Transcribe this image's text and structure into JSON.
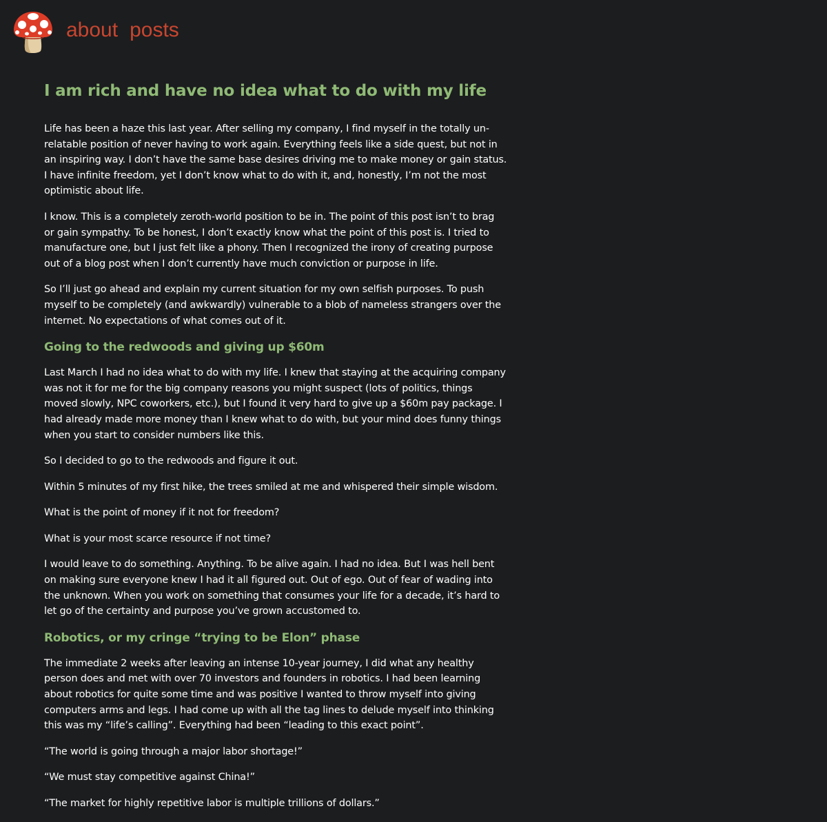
{
  "nav": {
    "logo_icon": "mushroom-icon",
    "links": [
      {
        "label": "about"
      },
      {
        "label": "posts"
      }
    ],
    "link_color": "#c8462f"
  },
  "article": {
    "title": "I am rich and have no idea what to do with my life",
    "accent_color": "#8fba75",
    "intro_paragraphs": [
      "Life has been a haze this last year. After selling my company, I find myself in the totally un-relatable position of never having to work again. Everything feels like a side quest, but not in an inspiring way. I don’t have the same base desires driving me to make money or gain status. I have infinite freedom, yet I don’t know what to do with it, and, honestly, I’m not the most optimistic about life.",
      "I know. This is a completely zeroth-world position to be in. The point of this post isn’t to brag or gain sympathy. To be honest, I don’t exactly know what the point of this post is. I tried to manufacture one, but I just felt like a phony. Then I recognized the irony of creating purpose out of a blog post when I don’t currently have much conviction or purpose in life.",
      "So I’ll just go ahead and explain my current situation for my own selfish purposes. To push myself to be completely (and awkwardly) vulnerable to a blob of nameless strangers over the internet. No expectations of what comes out of it."
    ],
    "sections": [
      {
        "heading": "Going to the redwoods and giving up $60m",
        "paragraphs": [
          "Last March I had no idea what to do with my life. I knew that staying at the acquiring company was not it for me for the big company reasons you might suspect (lots of politics, things moved slowly, NPC coworkers, etc.), but I found it very hard to give up a $60m pay package. I had already made more money than I knew what to do with, but your mind does funny things when you start to consider numbers like this.",
          "So I decided to go to the redwoods and figure it out.",
          "Within 5 minutes of my first hike, the trees smiled at me and whispered their simple wisdom.",
          "What is the point of money if it not for freedom?",
          "What is your most scarce resource if not time?",
          "I would leave to do something. Anything. To be alive again. I had no idea. But I was hell bent on making sure everyone knew I had it all figured out. Out of ego. Out of fear of wading into the unknown. When you work on something that consumes your life for a decade, it’s hard to let go of the certainty and purpose you’ve grown accustomed to."
        ]
      },
      {
        "heading": "Robotics, or my cringe “trying to be Elon” phase",
        "paragraphs": [
          "The immediate 2 weeks after leaving an intense 10-year journey, I did what any healthy person does and met with over 70 investors and founders in robotics. I had been learning about robotics for quite some time and was positive I wanted to throw myself into giving computers arms and legs. I had come up with all the tag lines to delude myself into thinking this was my “life’s calling”. Everything had been “leading to this exact point”.",
          "“The world is going through a major labor shortage!”",
          "“We must stay competitive against China!”",
          "“The market for highly repetitive labor is multiple trillions of dollars.”"
        ]
      }
    ]
  }
}
